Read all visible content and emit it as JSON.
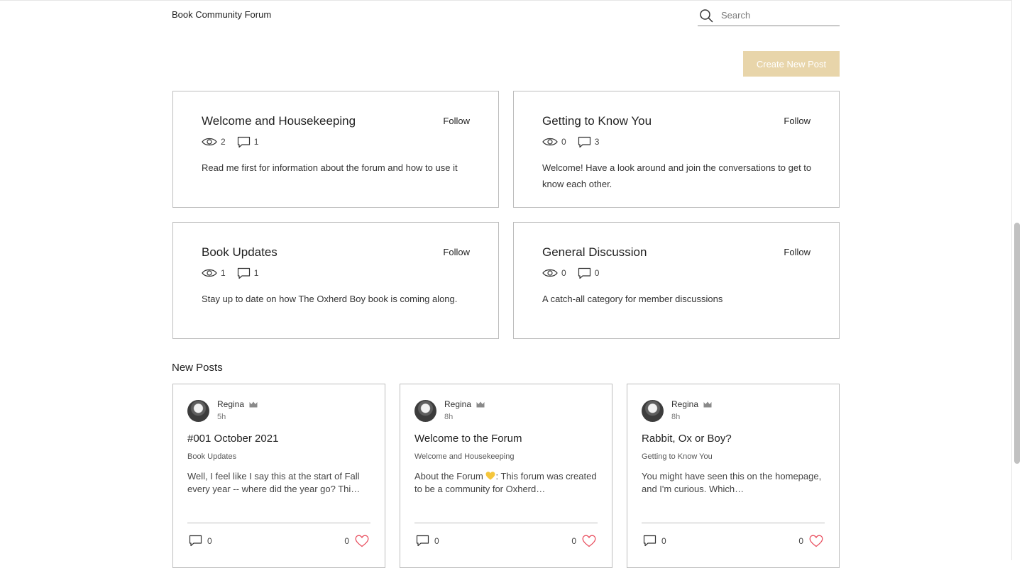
{
  "header": {
    "forum_title": "Book Community Forum",
    "search_placeholder": "Search"
  },
  "actions": {
    "create_post_label": "Create New Post"
  },
  "colors": {
    "accent_button": "#e8d5aa",
    "like_heart": "#e94f5f"
  },
  "categories": [
    {
      "title": "Welcome and Housekeeping",
      "follow": "Follow",
      "views": "2",
      "comments": "1",
      "description": "Read me first for information about the forum and how to use it"
    },
    {
      "title": "Getting to Know You",
      "follow": "Follow",
      "views": "0",
      "comments": "3",
      "description": "Welcome! Have a look around and join the conversations to get to know each other."
    },
    {
      "title": "Book Updates",
      "follow": "Follow",
      "views": "1",
      "comments": "1",
      "description": "Stay up to date on how The Oxherd Boy book is coming along."
    },
    {
      "title": "General Discussion",
      "follow": "Follow",
      "views": "0",
      "comments": "0",
      "description": "A catch-all category for member discussions"
    }
  ],
  "new_posts": {
    "heading": "New Posts",
    "posts": [
      {
        "author": "Regina",
        "time": "5h",
        "title": "#001 October 2021",
        "category": "Book Updates",
        "excerpt": "Well, I feel like I say this at the start of Fall every year -- where did the year go? Thi…",
        "comments": "0",
        "likes": "0"
      },
      {
        "author": "Regina",
        "time": "8h",
        "title": "Welcome to the Forum",
        "category": "Welcome and Housekeeping",
        "excerpt_before": "About the Forum ",
        "excerpt_after": ": This forum was created to be a community for Oxherd…",
        "comments": "0",
        "likes": "0"
      },
      {
        "author": "Regina",
        "time": "8h",
        "title": "Rabbit, Ox or Boy?",
        "category": "Getting to Know You",
        "excerpt": "You might have seen this on the homepage, and I'm curious. Which…",
        "comments": "0",
        "likes": "0"
      }
    ]
  }
}
